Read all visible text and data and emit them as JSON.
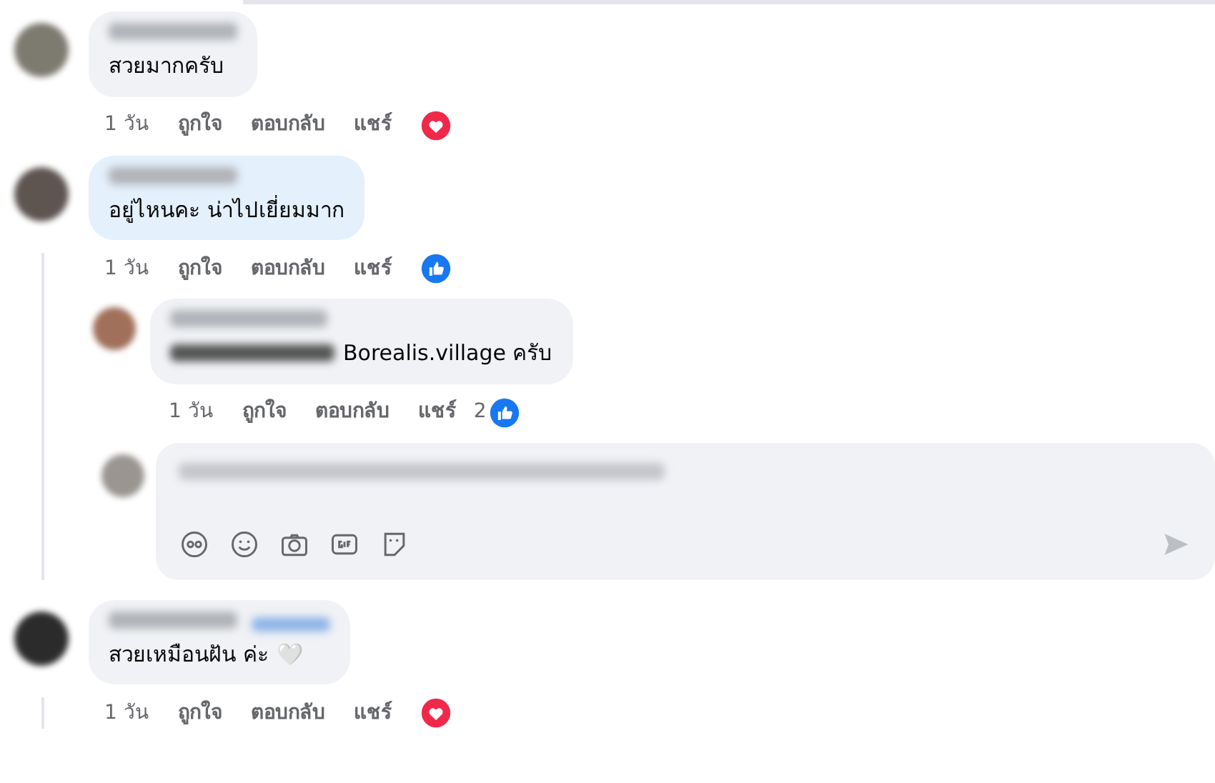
{
  "comments": [
    {
      "text": "สวยมากครับ",
      "color": "#f0f2f5",
      "actions": [
        "1 วัน",
        "ถูกใจ",
        "ตอบกลับ",
        "แชร์"
      ],
      "reaction": {
        "kind": "heart"
      }
    },
    {
      "text": "อยู่ไหนคะ น่าไปเยี่ยมมาก",
      "color": "#e4f0fb",
      "actions": [
        "1 วัน",
        "ถูกใจ",
        "ตอบกลับ",
        "แชร์"
      ],
      "reaction": {
        "kind": "like"
      },
      "replies": [
        {
          "text": "Borealis.village ครับ",
          "mention": true,
          "color": "#f0f2f5",
          "actions": [
            "1 วัน",
            "ถูกใจ",
            "ตอบกลับ",
            "แชร์"
          ],
          "reaction": {
            "kind": "like",
            "count": "2"
          }
        }
      ],
      "composer": true
    },
    {
      "text": "สวยเหมือนฝัน ค่ะ",
      "emoji": "🤍",
      "link": true,
      "color": "#f0f2f5",
      "actions": [
        "1 วัน",
        "ถูกใจ",
        "ตอบกลับ",
        "แชร์"
      ],
      "reaction": {
        "kind": "heart"
      }
    }
  ]
}
